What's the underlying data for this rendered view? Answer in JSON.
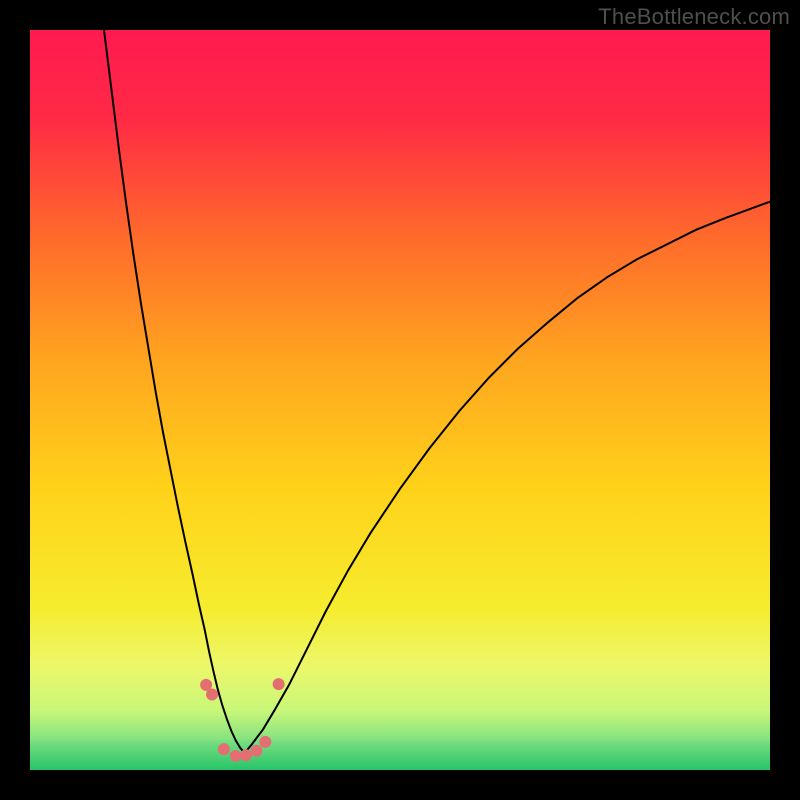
{
  "watermark": "TheBottleneck.com",
  "chart_data": {
    "type": "line",
    "title": "",
    "xlabel": "",
    "ylabel": "",
    "xlim": [
      0,
      100
    ],
    "ylim": [
      0,
      100
    ],
    "grid": false,
    "background_gradient": {
      "stops": [
        {
          "pos": 0.0,
          "color": "#ff1a50"
        },
        {
          "pos": 0.12,
          "color": "#ff2a45"
        },
        {
          "pos": 0.28,
          "color": "#ff6a2b"
        },
        {
          "pos": 0.45,
          "color": "#ffa61f"
        },
        {
          "pos": 0.62,
          "color": "#ffd21a"
        },
        {
          "pos": 0.78,
          "color": "#f6ec2e"
        },
        {
          "pos": 0.86,
          "color": "#ecf76a"
        },
        {
          "pos": 0.92,
          "color": "#c8f779"
        },
        {
          "pos": 0.965,
          "color": "#7adf80"
        },
        {
          "pos": 1.0,
          "color": "#27c469"
        }
      ]
    },
    "series": [
      {
        "name": "left-curve",
        "color": "#000000",
        "x": [
          10.0,
          11.0,
          12.0,
          13.0,
          14.0,
          15.0,
          16.0,
          17.0,
          18.0,
          19.0,
          20.0,
          21.0,
          22.0,
          22.8,
          23.6,
          24.2,
          24.8,
          25.4,
          26.0,
          26.6,
          27.2,
          27.8,
          28.4,
          29.0
        ],
        "y": [
          100.0,
          92.0,
          84.0,
          76.5,
          69.5,
          63.0,
          57.0,
          51.0,
          45.5,
          40.5,
          35.5,
          30.8,
          26.3,
          22.5,
          19.0,
          16.0,
          13.3,
          10.8,
          8.7,
          6.9,
          5.3,
          4.0,
          3.0,
          2.3
        ]
      },
      {
        "name": "right-curve",
        "color": "#000000",
        "x": [
          29.0,
          30.0,
          31.5,
          33.0,
          35.0,
          37.0,
          40.0,
          43.0,
          46.0,
          50.0,
          54.0,
          58.0,
          62.0,
          66.0,
          70.0,
          74.0,
          78.0,
          82.0,
          86.0,
          90.0,
          94.0,
          97.0,
          100.0
        ],
        "y": [
          2.3,
          3.5,
          5.5,
          8.0,
          11.5,
          15.5,
          21.5,
          27.0,
          32.0,
          38.0,
          43.5,
          48.5,
          53.0,
          57.0,
          60.5,
          63.8,
          66.6,
          69.0,
          71.0,
          73.0,
          74.6,
          75.7,
          76.8
        ]
      }
    ],
    "markers": {
      "color": "#e36f72",
      "radius_px": 6,
      "points": [
        {
          "x": 23.8,
          "y": 11.5
        },
        {
          "x": 24.6,
          "y": 10.2
        },
        {
          "x": 26.2,
          "y": 2.8
        },
        {
          "x": 27.8,
          "y": 1.9
        },
        {
          "x": 29.2,
          "y": 2.0
        },
        {
          "x": 30.6,
          "y": 2.6
        },
        {
          "x": 31.8,
          "y": 3.8
        },
        {
          "x": 33.6,
          "y": 11.6
        }
      ]
    },
    "green_band": {
      "y_from": 0,
      "y_to": 4,
      "color_top": "#7adf80",
      "color_bottom": "#27c469"
    }
  }
}
